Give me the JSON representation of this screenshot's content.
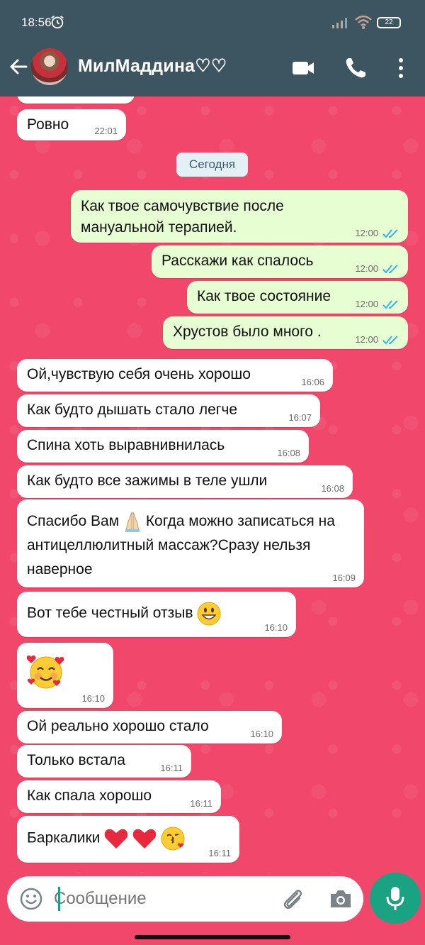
{
  "status_bar": {
    "time": "18:56",
    "battery": "22"
  },
  "header": {
    "contact_name": "МилМаддина♡♡"
  },
  "date_chip": "Сегодня",
  "messages": [
    {
      "dir": "in",
      "text": "Ровно",
      "time": "22:01"
    },
    {
      "dir": "out",
      "text": "Как твое самочувствие после мануальной терапией.",
      "time": "12:00"
    },
    {
      "dir": "out",
      "text": "Расскажи как спалось",
      "time": "12:00"
    },
    {
      "dir": "out",
      "text": "Как твое состояние",
      "time": "12:00"
    },
    {
      "dir": "out",
      "text": "Хрустов было много .",
      "time": "12:00"
    },
    {
      "dir": "in",
      "text": "Ой,чувствую себя очень хорошо",
      "time": "16:06"
    },
    {
      "dir": "in",
      "text": "Как будто дышать стало легче",
      "time": "16:07"
    },
    {
      "dir": "in",
      "text": "Спина хоть выравнивнилась",
      "time": "16:08"
    },
    {
      "dir": "in",
      "text": "Как будто все зажимы в теле ушли",
      "time": "16:08"
    },
    {
      "dir": "in",
      "text_a": "Спасибо Вам",
      "text_b": " Когда можно записаться на антицеллюлитный массаж?Сразу нельзя наверное",
      "time": "16:09"
    },
    {
      "dir": "in",
      "text": "Вот тебе честный отзыв",
      "time": "16:10"
    },
    {
      "dir": "in",
      "text": "",
      "time": "16:10"
    },
    {
      "dir": "in",
      "text": "Ой реально хорошо стало",
      "time": "16:10"
    },
    {
      "dir": "in",
      "text": "Только встала",
      "time": "16:11"
    },
    {
      "dir": "in",
      "text": "Как спала хорошо",
      "time": "16:11"
    },
    {
      "dir": "in",
      "text": "Баркалики",
      "time": "16:11"
    }
  ],
  "composer": {
    "placeholder": "Сообщение"
  },
  "colors": {
    "header": "#3d5561",
    "chat_bg": "#f0476a",
    "outgoing": "#e7fdd2",
    "incoming": "#ffffff",
    "accent": "#1aa383",
    "read_ticks": "#34b7f1"
  }
}
